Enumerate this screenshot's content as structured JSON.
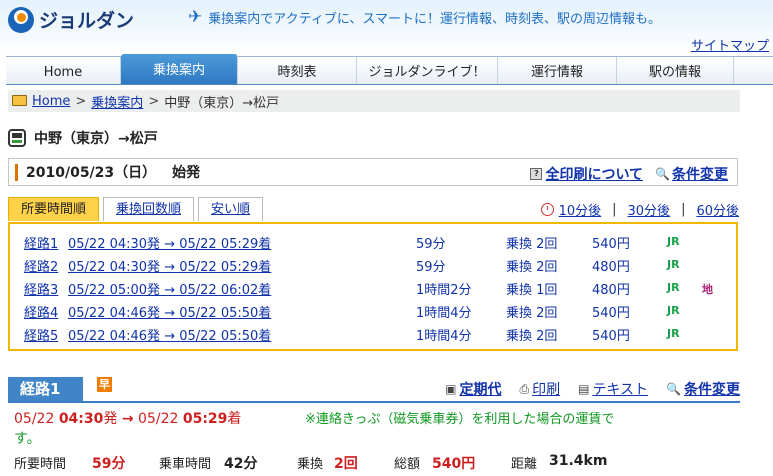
{
  "header": {
    "logo_text": "ジョルダン",
    "tagline": "乗換案内でアクティブに、スマートに！運行情報、時刻表、駅の周辺情報も。",
    "sitemap": "サイトマップ"
  },
  "nav": [
    "Home",
    "乗換案内",
    "時刻表",
    "ジョルダンライブ！",
    "運行情報",
    "駅の情報"
  ],
  "breadcrumb": {
    "home": "Home",
    "sep1": ">",
    "transfer": "乗換案内",
    "sep2": ">",
    "current": "中野（東京）→松戸"
  },
  "route_title": "中野（東京）→松戸",
  "datebar": {
    "date": "2010/05/23（日）",
    "first_train": "始発",
    "print": "全印刷について",
    "change": "条件変更"
  },
  "tabs": [
    "所要時間順",
    "乗換回数順",
    "安い順"
  ],
  "later": [
    "10分後",
    "30分後",
    "60分後"
  ],
  "later_sep": "|",
  "routes": [
    {
      "name": "経路1",
      "times": "05/22 04:30発 → 05/22 05:29着",
      "duration": "59分",
      "transfers": "乗換 2回",
      "fare": "540円",
      "line": "JR",
      "extra": ""
    },
    {
      "name": "経路2",
      "times": "05/22 04:30発 → 05/22 05:29着",
      "duration": "59分",
      "transfers": "乗換 2回",
      "fare": "480円",
      "line": "JR",
      "extra": ""
    },
    {
      "name": "経路3",
      "times": "05/22 05:00発 → 05/22 06:02着",
      "duration": "1時間2分",
      "transfers": "乗換 1回",
      "fare": "480円",
      "line": "JR",
      "extra": "地"
    },
    {
      "name": "経路4",
      "times": "05/22 04:46発 → 05/22 05:50着",
      "duration": "1時間4分",
      "transfers": "乗換 2回",
      "fare": "540円",
      "line": "JR",
      "extra": ""
    },
    {
      "name": "経路5",
      "times": "05/22 04:46発 → 05/22 05:50着",
      "duration": "1時間4分",
      "transfers": "乗換 2回",
      "fare": "540円",
      "line": "JR",
      "extra": ""
    }
  ],
  "detail": {
    "route_label": "経路1",
    "badge": "早",
    "links": [
      "定期代",
      "印刷",
      "テキスト",
      "条件変更"
    ],
    "dep_date": "05/22",
    "dep_time": "04:30",
    "dep_suffix": "発",
    "arrow": "→",
    "arr_date": "05/22",
    "arr_time": "05:29",
    "arr_suffix": "着",
    "notice": "※連絡きっぷ（磁気乗車券）を利用した場合の運賃です。",
    "notice_line1": "※連絡きっぷ（磁気乗車券）を利用した場合の運賃で",
    "notice_line2": "す。",
    "stats": {
      "total_time_label": "所要時間",
      "total_time": "59分",
      "ride_time_label": "乗車時間",
      "ride_time": "42分",
      "transfer_label": "乗換",
      "transfer": "2回",
      "fare_label": "総額",
      "fare": "540円",
      "distance_label": "距離",
      "distance": "31.4km"
    }
  },
  "colors": {
    "brand_blue": "#1a64b7",
    "accent_orange": "#f08a00",
    "tab_yellow": "#ffd24a",
    "link": "#1133aa",
    "red": "#cc1f1f",
    "green": "#119922"
  }
}
